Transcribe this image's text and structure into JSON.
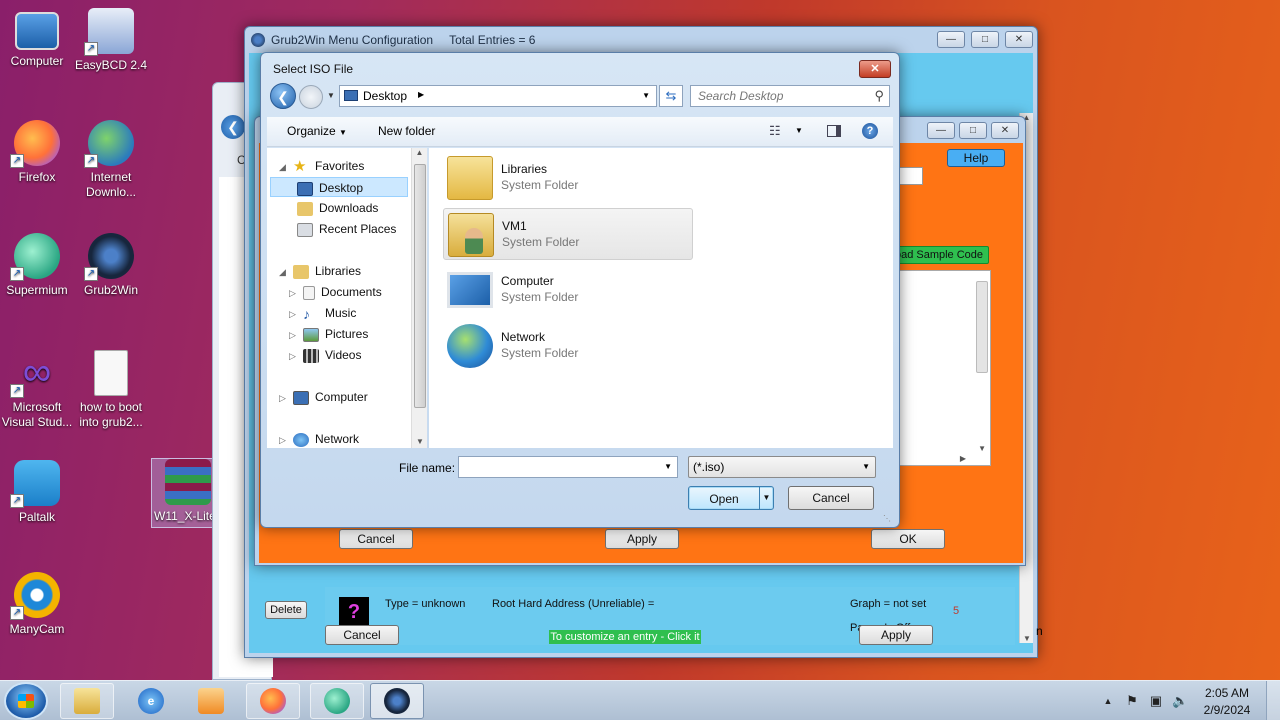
{
  "desktop": {
    "icons": [
      {
        "label": "Computer"
      },
      {
        "label": "EasyBCD 2.4"
      },
      {
        "label": "Firefox"
      },
      {
        "label": "Internet Downlo..."
      },
      {
        "label": "Supermium"
      },
      {
        "label": "Grub2Win"
      },
      {
        "label": "Microsoft Visual Stud..."
      },
      {
        "label": "how to boot into grub2..."
      },
      {
        "label": "Paltalk"
      },
      {
        "label": "W11_X-Lite"
      },
      {
        "label": "ManyCam"
      }
    ]
  },
  "grub_window": {
    "title": "Grub2Win Menu Configuration",
    "total_entries": "Total Entries = 6",
    "delete_label": "Delete",
    "type_text": "Type = unknown",
    "root_text": "Root Hard Address (Unreliable) =",
    "graph_text": "Graph = not set",
    "pause_text": "Pause Is Off",
    "number": "5",
    "cancel_label": "Cancel",
    "customize_label": "To customize an entry - Click it",
    "apply_label": "Apply"
  },
  "edit_window": {
    "help_label": "Help",
    "sample_code_label": "oad Sample Code",
    "cancel_label": "Cancel",
    "apply_label": "Apply",
    "ok_label": "OK"
  },
  "back_window": {
    "letter_c": "C"
  },
  "dialog": {
    "title": "Select ISO File",
    "address": "Desktop",
    "search_placeholder": "Search Desktop",
    "organize_label": "Organize",
    "new_folder_label": "New folder",
    "nav": {
      "favorites": "Favorites",
      "desktop": "Desktop",
      "downloads": "Downloads",
      "recent": "Recent Places",
      "libraries": "Libraries",
      "documents": "Documents",
      "music": "Music",
      "pictures": "Pictures",
      "videos": "Videos",
      "computer": "Computer",
      "network": "Network"
    },
    "items": [
      {
        "name": "Libraries",
        "type": "System Folder"
      },
      {
        "name": "VM1",
        "type": "System Folder"
      },
      {
        "name": "Computer",
        "type": "System Folder"
      },
      {
        "name": "Network",
        "type": "System Folder"
      }
    ],
    "filename_label": "File name:",
    "filename_value": "",
    "filter_value": "(*.iso)",
    "open_label": "Open",
    "cancel_label": "Cancel"
  },
  "taskbar": {
    "time": "2:05 AM",
    "date": "2/9/2024"
  },
  "colors": {
    "orange_panel": "#ff7414",
    "grub_bg": "#66c9ef",
    "green_button": "#2fbf4f"
  }
}
